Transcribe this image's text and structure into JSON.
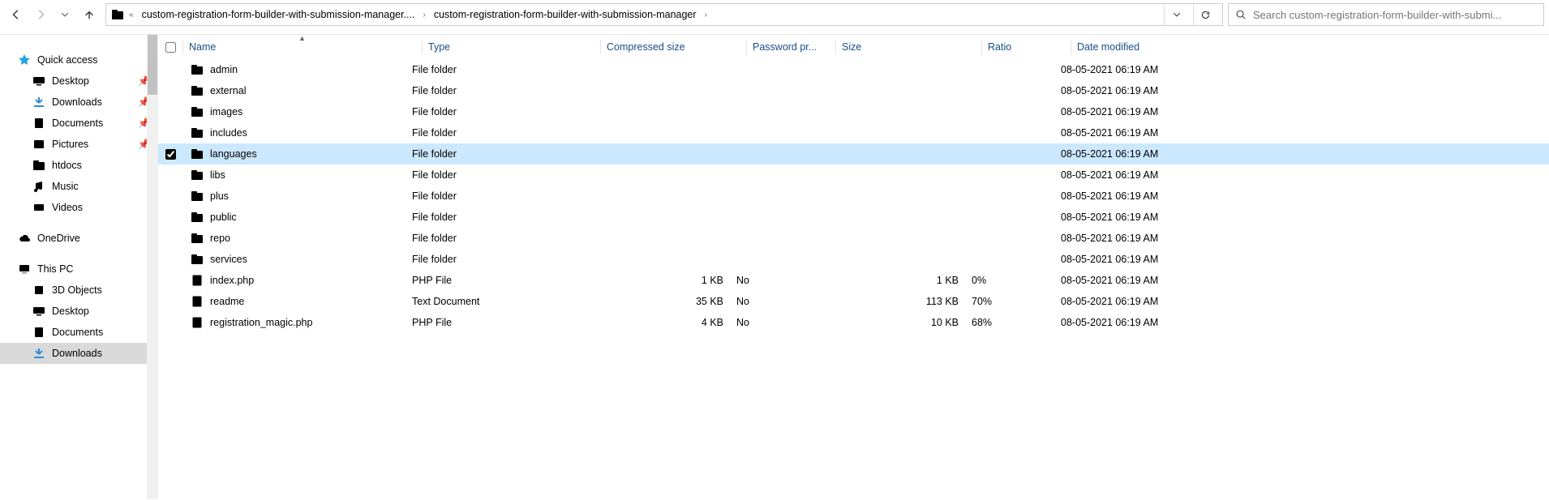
{
  "toolbar": {
    "back_enabled": true,
    "forward_enabled": false,
    "breadcrumbs": [
      "custom-registration-form-builder-with-submission-manager....",
      "custom-registration-form-builder-with-submission-manager"
    ],
    "search_placeholder": "Search custom-registration-form-builder-with-submi..."
  },
  "navpane": {
    "quick_access": "Quick access",
    "items_quick": [
      {
        "icon": "desktop",
        "label": "Desktop",
        "pinned": true
      },
      {
        "icon": "download",
        "label": "Downloads",
        "pinned": true
      },
      {
        "icon": "doc",
        "label": "Documents",
        "pinned": true
      },
      {
        "icon": "pic",
        "label": "Pictures",
        "pinned": true
      },
      {
        "icon": "folder",
        "label": "htdocs",
        "pinned": false
      },
      {
        "icon": "music",
        "label": "Music",
        "pinned": false
      },
      {
        "icon": "video",
        "label": "Videos",
        "pinned": false
      }
    ],
    "onedrive": "OneDrive",
    "thispc": "This PC",
    "items_thispc": [
      {
        "icon": "3d",
        "label": "3D Objects"
      },
      {
        "icon": "desktop",
        "label": "Desktop"
      },
      {
        "icon": "doc",
        "label": "Documents"
      },
      {
        "icon": "download",
        "label": "Downloads",
        "selected": true
      }
    ]
  },
  "columns": {
    "name": "Name",
    "type": "Type",
    "compressed": "Compressed size",
    "password": "Password pr...",
    "size": "Size",
    "ratio": "Ratio",
    "date": "Date modified"
  },
  "rows": [
    {
      "icon": "folder",
      "name": "admin",
      "type": "File folder",
      "comp": "",
      "pass": "",
      "size": "",
      "ratio": "",
      "date": "08-05-2021 06:19 AM",
      "selected": false
    },
    {
      "icon": "folder",
      "name": "external",
      "type": "File folder",
      "comp": "",
      "pass": "",
      "size": "",
      "ratio": "",
      "date": "08-05-2021 06:19 AM",
      "selected": false
    },
    {
      "icon": "folder",
      "name": "images",
      "type": "File folder",
      "comp": "",
      "pass": "",
      "size": "",
      "ratio": "",
      "date": "08-05-2021 06:19 AM",
      "selected": false
    },
    {
      "icon": "folder",
      "name": "includes",
      "type": "File folder",
      "comp": "",
      "pass": "",
      "size": "",
      "ratio": "",
      "date": "08-05-2021 06:19 AM",
      "selected": false
    },
    {
      "icon": "folder",
      "name": "languages",
      "type": "File folder",
      "comp": "",
      "pass": "",
      "size": "",
      "ratio": "",
      "date": "08-05-2021 06:19 AM",
      "selected": true
    },
    {
      "icon": "folder",
      "name": "libs",
      "type": "File folder",
      "comp": "",
      "pass": "",
      "size": "",
      "ratio": "",
      "date": "08-05-2021 06:19 AM",
      "selected": false
    },
    {
      "icon": "folder",
      "name": "plus",
      "type": "File folder",
      "comp": "",
      "pass": "",
      "size": "",
      "ratio": "",
      "date": "08-05-2021 06:19 AM",
      "selected": false
    },
    {
      "icon": "folder",
      "name": "public",
      "type": "File folder",
      "comp": "",
      "pass": "",
      "size": "",
      "ratio": "",
      "date": "08-05-2021 06:19 AM",
      "selected": false
    },
    {
      "icon": "folder",
      "name": "repo",
      "type": "File folder",
      "comp": "",
      "pass": "",
      "size": "",
      "ratio": "",
      "date": "08-05-2021 06:19 AM",
      "selected": false
    },
    {
      "icon": "folder",
      "name": "services",
      "type": "File folder",
      "comp": "",
      "pass": "",
      "size": "",
      "ratio": "",
      "date": "08-05-2021 06:19 AM",
      "selected": false
    },
    {
      "icon": "file",
      "name": "index.php",
      "type": "PHP File",
      "comp": "1 KB",
      "pass": "No",
      "size": "1 KB",
      "ratio": "0%",
      "date": "08-05-2021 06:19 AM",
      "selected": false
    },
    {
      "icon": "txt",
      "name": "readme",
      "type": "Text Document",
      "comp": "35 KB",
      "pass": "No",
      "size": "113 KB",
      "ratio": "70%",
      "date": "08-05-2021 06:19 AM",
      "selected": false
    },
    {
      "icon": "file",
      "name": "registration_magic.php",
      "type": "PHP File",
      "comp": "4 KB",
      "pass": "No",
      "size": "10 KB",
      "ratio": "68%",
      "date": "08-05-2021 06:19 AM",
      "selected": false
    }
  ]
}
